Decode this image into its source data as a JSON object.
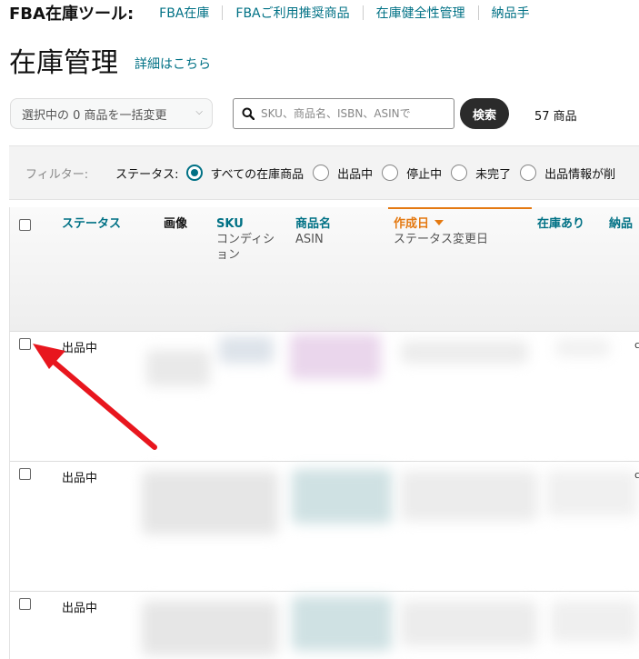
{
  "header": {
    "brand": "FBA在庫ツール:",
    "nav": [
      "FBA在庫",
      "FBAご利用推奨商品",
      "在庫健全性管理",
      "納品手"
    ]
  },
  "page": {
    "title": "在庫管理",
    "detail_link": "詳細はこちら"
  },
  "toolbar": {
    "bulk_select_label": "選択中の 0 商品を一括変更",
    "search_placeholder": "SKU、商品名、ISBN、ASINで",
    "search_button": "検索",
    "count": "57 商品"
  },
  "filter": {
    "label": "フィルター:",
    "status_label": "ステータス:",
    "options": [
      "すべての在庫商品",
      "出品中",
      "停止中",
      "未完了",
      "出品情報が削"
    ],
    "selected_index": 0
  },
  "table": {
    "columns": {
      "status": "ステータス",
      "image": "画像",
      "sku": "SKU",
      "sku_sub": "コンディション",
      "name": "商品名",
      "name_sub": "ASIN",
      "date": "作成日",
      "date_sub": "ステータス変更日",
      "stock": "在庫あり",
      "inbound": "納品"
    },
    "rows": [
      {
        "status": "出品中"
      },
      {
        "status": "出品中"
      },
      {
        "status": "出品中"
      }
    ]
  },
  "colors": {
    "link": "#007185",
    "sort_accent": "#e47911",
    "annotation_arrow": "#e8161e"
  }
}
